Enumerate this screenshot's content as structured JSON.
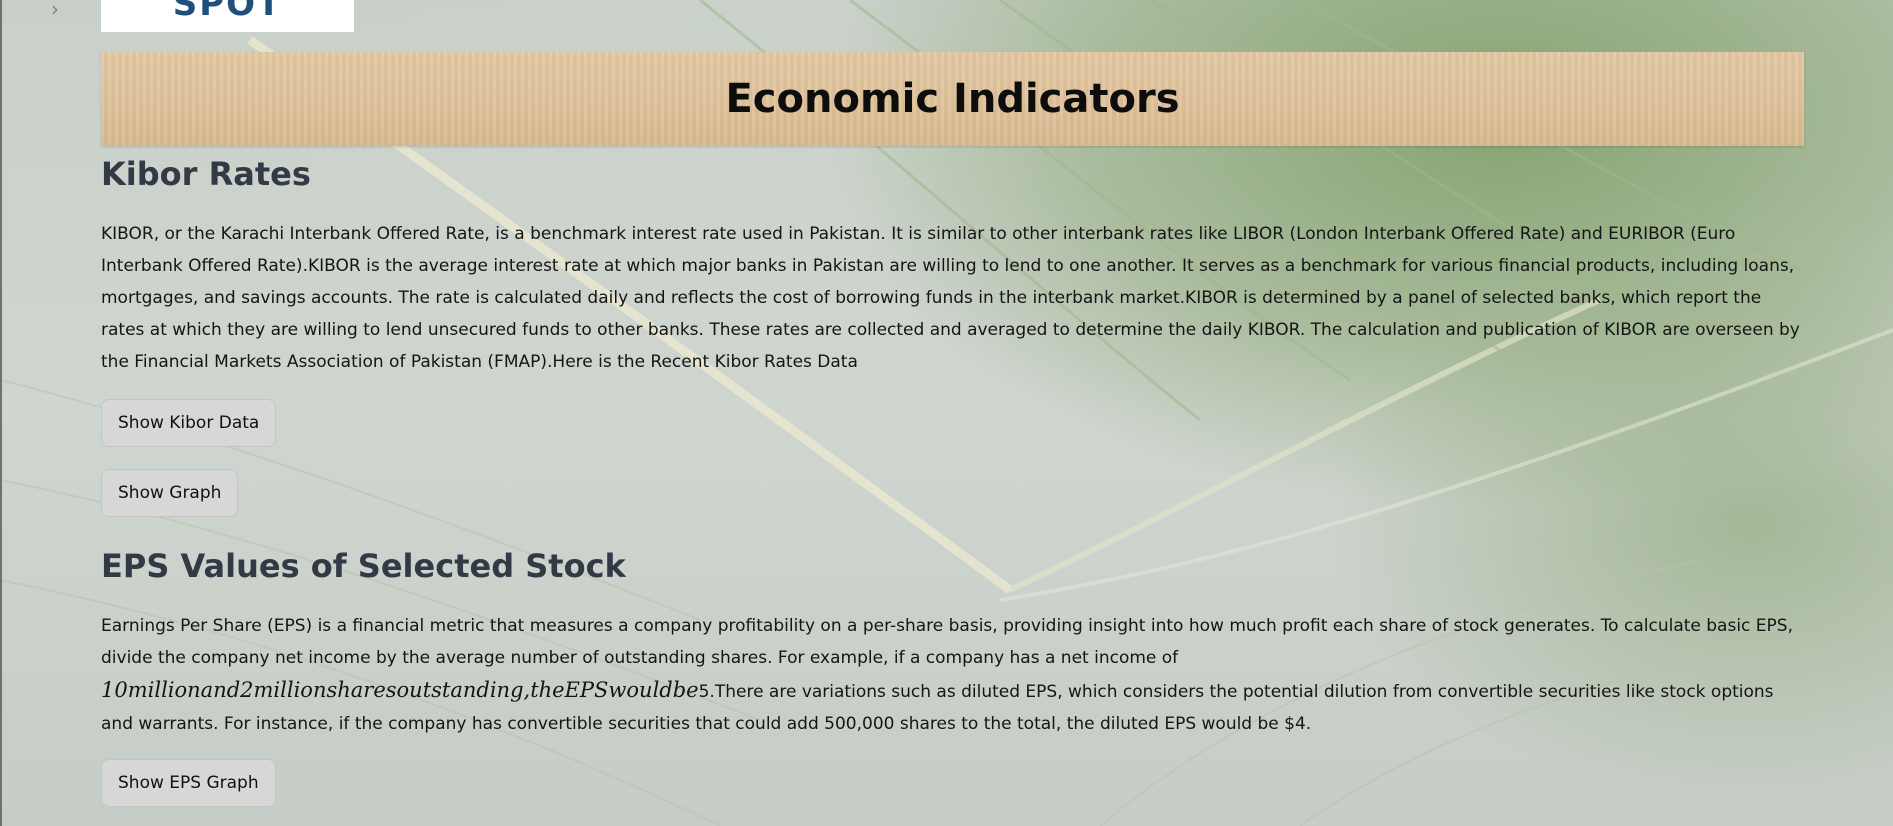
{
  "sidebar": {
    "toggle_icon": "chevron-right-icon",
    "toggle_glyph": "›"
  },
  "logo": {
    "text": "SPOT"
  },
  "page": {
    "title": "Economic Indicators"
  },
  "kibor": {
    "heading": "Kibor Rates",
    "description": "KIBOR, or the Karachi Interbank Offered Rate, is a benchmark interest rate used in Pakistan. It is similar to other interbank rates like LIBOR (London Interbank Offered Rate) and EURIBOR (Euro Interbank Offered Rate).KIBOR is the average interest rate at which major banks in Pakistan are willing to lend to one another. It serves as a benchmark for various financial products, including loans, mortgages, and savings accounts. The rate is calculated daily and reflects the cost of borrowing funds in the interbank market.KIBOR is determined by a panel of selected banks, which report the rates at which they are willing to lend unsecured funds to other banks. These rates are collected and averaged to determine the daily KIBOR. The calculation and publication of KIBOR are overseen by the Financial Markets Association of Pakistan (FMAP).Here is the Recent Kibor Rates Data",
    "show_data_label": "Show Kibor Data",
    "show_graph_label": "Show Graph"
  },
  "eps": {
    "heading": "EPS Values of Selected Stock",
    "description_part1": "Earnings Per Share (EPS) is a financial metric that measures a company profitability on a per-share basis, providing insight into how much profit each share of stock generates. To calculate basic EPS, divide the company net income by the average number of outstanding shares. For example, if a company has a net income of ",
    "description_math": "10millionand2millionsharesoutstanding,theEPSwouldbe",
    "description_part2": "5.There are variations such as diluted EPS, which considers the potential dilution from convertible securities like stock options and warrants. For instance, if the company has convertible securities that could add 500,000 shares to the total, the diluted EPS would be $4.",
    "show_graph_label": "Show EPS Graph"
  }
}
